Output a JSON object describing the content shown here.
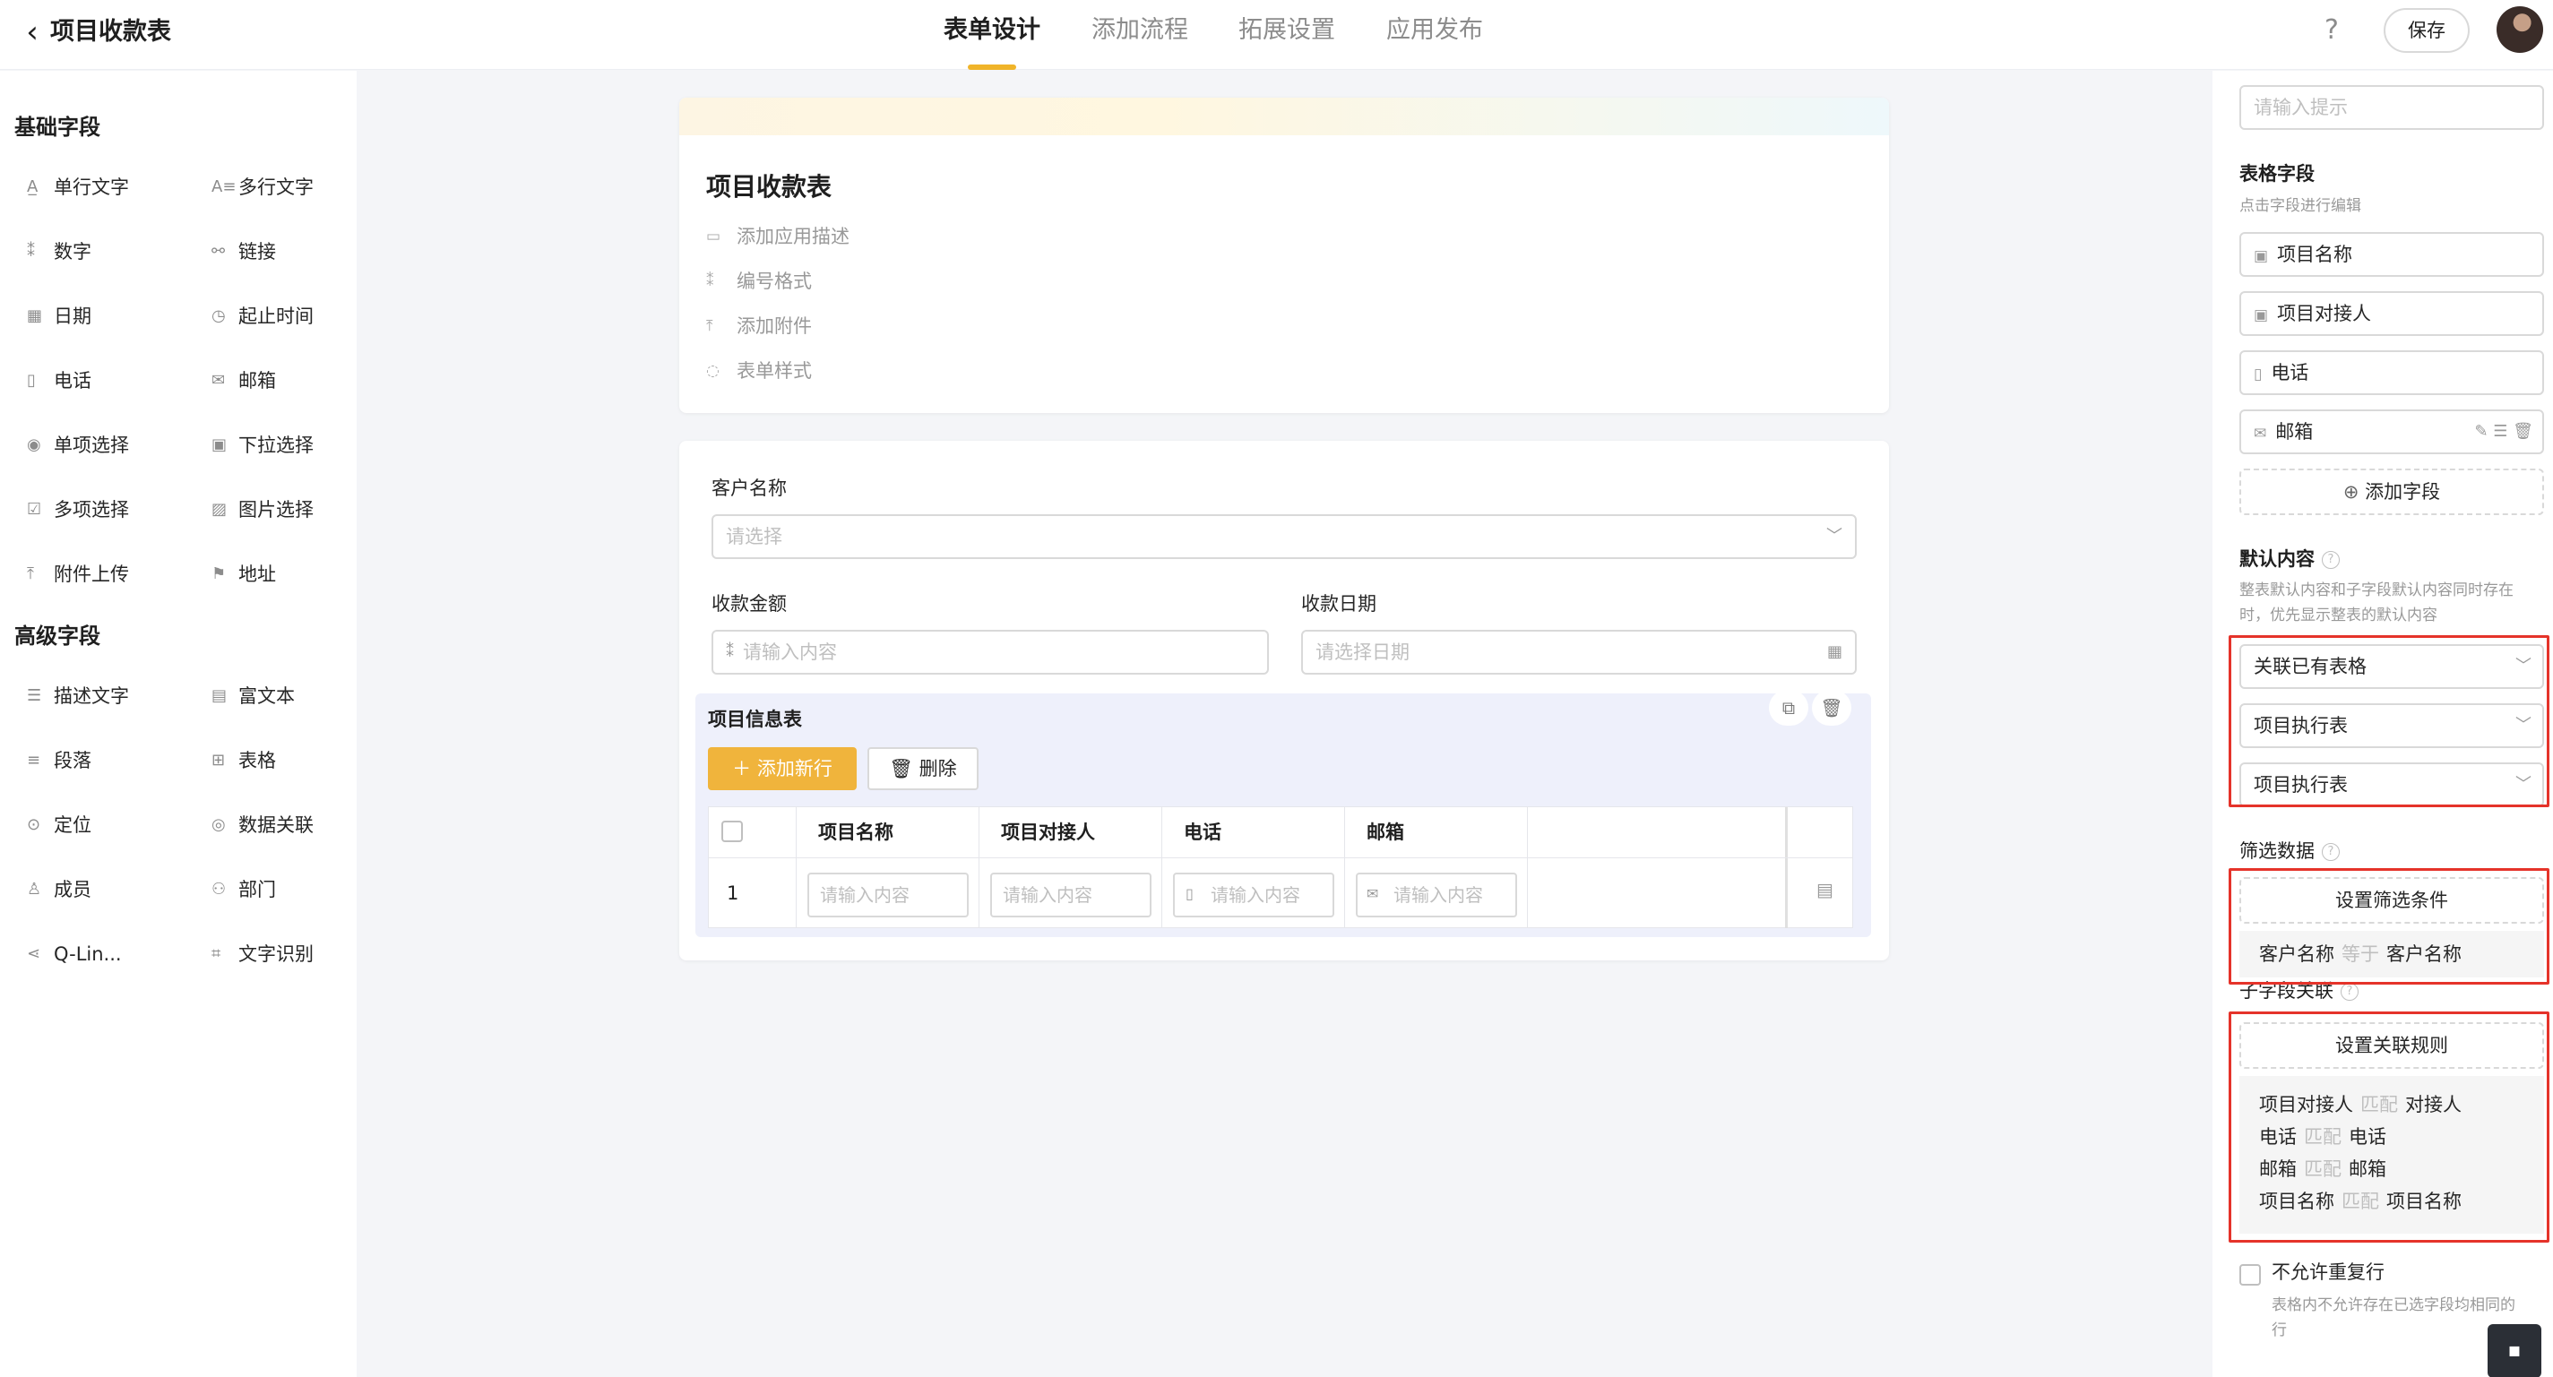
{
  "header": {
    "back_icon": "chevron-left-icon",
    "title": "项目收款表",
    "tabs": [
      "表单设计",
      "添加流程",
      "拓展设置",
      "应用发布"
    ],
    "active_tab": "表单设计",
    "help": "?",
    "save": "保存",
    "accent_color": "#f0b429"
  },
  "left": {
    "basic_title": "基础字段",
    "basic": [
      [
        "单行文字",
        "多行文字"
      ],
      [
        "数字",
        "链接"
      ],
      [
        "日期",
        "起止时间"
      ],
      [
        "电话",
        "邮箱"
      ],
      [
        "单项选择",
        "下拉选择"
      ],
      [
        "多项选择",
        "图片选择"
      ],
      [
        "附件上传",
        "地址"
      ]
    ],
    "advanced_title": "高级字段",
    "advanced": [
      [
        "描述文字",
        "富文本"
      ],
      [
        "段落",
        "表格"
      ],
      [
        "定位",
        "数据关联"
      ],
      [
        "成员",
        "部门"
      ],
      [
        "Q-Lin...",
        "文字识别"
      ]
    ]
  },
  "form": {
    "title": "项目收款表",
    "meta": [
      "添加应用描述",
      "编号格式",
      "添加附件",
      "表单样式"
    ],
    "customer": {
      "label": "客户名称",
      "placeholder": "请选择"
    },
    "amount": {
      "label": "收款金额",
      "placeholder": "请输入内容"
    },
    "date": {
      "label": "收款日期",
      "placeholder": "请选择日期"
    },
    "subtable": {
      "title": "项目信息表",
      "add_row": "添加新行",
      "delete": "删除",
      "columns": [
        "项目名称",
        "项目对接人",
        "电话",
        "邮箱"
      ],
      "row_index": "1",
      "cell_placeholder": "请输入内容"
    }
  },
  "right": {
    "hint_placeholder": "请输入提示",
    "table_fields_title": "表格字段",
    "table_fields_hint": "点击字段进行编辑",
    "fields": [
      "项目名称",
      "项目对接人",
      "电话",
      "邮箱"
    ],
    "add_field": "添加字段",
    "default_title": "默认内容",
    "default_hint_1": "整表默认内容和子字段默认内容同时存在",
    "default_hint_2": "时，优先显示整表的默认内容",
    "default_selects": [
      "关联已有表格",
      "项目执行表",
      "项目执行表"
    ],
    "filter_title": "筛选数据",
    "filter_button": "设置筛选条件",
    "filter_rule": {
      "left": "客户名称",
      "op": "等于",
      "right": "客户名称"
    },
    "link_title": "子字段关联",
    "link_button": "设置关联规则",
    "link_rules": [
      {
        "left": "项目对接人",
        "op": "匹配",
        "right": "对接人"
      },
      {
        "left": "电话",
        "op": "匹配",
        "right": "电话"
      },
      {
        "left": "邮箱",
        "op": "匹配",
        "right": "邮箱"
      },
      {
        "left": "项目名称",
        "op": "匹配",
        "right": "项目名称"
      }
    ],
    "no_dup_label": "不允许重复行",
    "no_dup_hint_1": "表格内不允许存在已选字段均相同的",
    "no_dup_hint_2": "行",
    "highlight_color": "#e5332a"
  }
}
